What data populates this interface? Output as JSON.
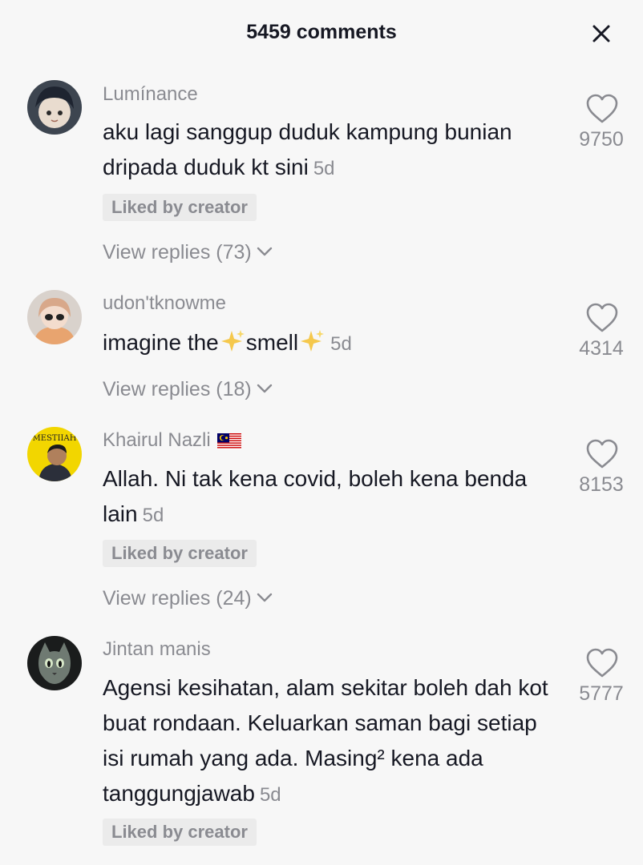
{
  "header": {
    "title": "5459 comments",
    "close_icon": "close-icon"
  },
  "comments": [
    {
      "username": "Lumínance",
      "text": "aku lagi sanggup duduk kampung bunian dripada duduk kt sini",
      "time": "5d",
      "liked_by_creator": "Liked by creator",
      "replies": "View replies (73)",
      "likes": "9750"
    },
    {
      "username": "udon'tknowme",
      "text_parts": [
        "imagine the",
        "smell"
      ],
      "time": "5d",
      "replies": "View replies (18)",
      "likes": "4314"
    },
    {
      "username": "Khairul Nazli",
      "flag": "malaysia-flag",
      "text": "Allah. Ni tak kena covid, boleh kena benda lain",
      "time": "5d",
      "liked_by_creator": "Liked by creator",
      "replies": "View replies (24)",
      "likes": "8153",
      "avatar_text": "MESTIIAH"
    },
    {
      "username": "Jintan manis",
      "text": "Agensi kesihatan, alam sekitar boleh dah kot buat rondaan. Keluarkan saman bagi setiap isi rumah yang ada. Masing² kena ada tanggungjawab",
      "time": "5d",
      "liked_by_creator": "Liked by creator",
      "likes": "5777"
    }
  ],
  "colors": {
    "background": "#f7f7f7",
    "text": "#161823",
    "muted": "#8a8b91",
    "badge_bg": "#ebebeb"
  }
}
